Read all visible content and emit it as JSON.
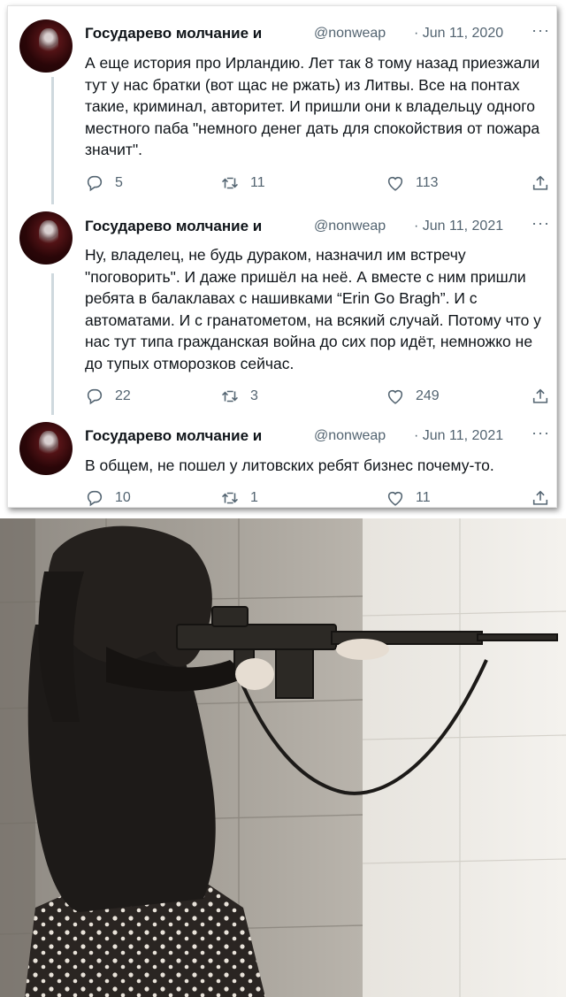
{
  "tweets": [
    {
      "name": "Государево молчание и",
      "handle": "@nonweap",
      "date": "· Jun 11, 2020",
      "text": "А еще история про Ирландию. Лет так 8 тому назад приезжали тут у нас братки (вот щас не ржать) из Литвы. Все на понтах такие, криминал, авторитет. И пришли они к владельцу одного местного паба \"немного денег дать для спокойствия от пожара значит\".",
      "replies": "5",
      "retweets": "11",
      "likes": "113"
    },
    {
      "name": "Государево молчание и",
      "handle": "@nonweap",
      "date": "· Jun 11, 2021",
      "text": "Ну, владелец, не будь дураком, назначил им встречу \"поговорить\". И даже пришёл на неё. А вместе с ним пришли ребята в балаклавах с нашивками “Erin Go Bragh”. И с автоматами. И с гранатометом, на всякий случай. Потому что у нас тут типа гражданская война до сих пор идёт, немножко не до тупых отморозков сейчас.",
      "replies": "22",
      "retweets": "3",
      "likes": "249"
    },
    {
      "name": "Государево молчание и",
      "handle": "@nonweap",
      "date": "· Jun 11, 2021",
      "text": "В общем, не пошел у литовских ребят бизнес почему-то.",
      "replies": "10",
      "retweets": "1",
      "likes": "11"
    }
  ],
  "more_glyph": "···",
  "icons": [
    "reply-icon",
    "retweet-icon",
    "like-icon",
    "share-icon",
    "more-icon"
  ],
  "colors": {
    "text": "#0f1419",
    "secondary": "#536471",
    "thread_line": "#cfd9de"
  }
}
